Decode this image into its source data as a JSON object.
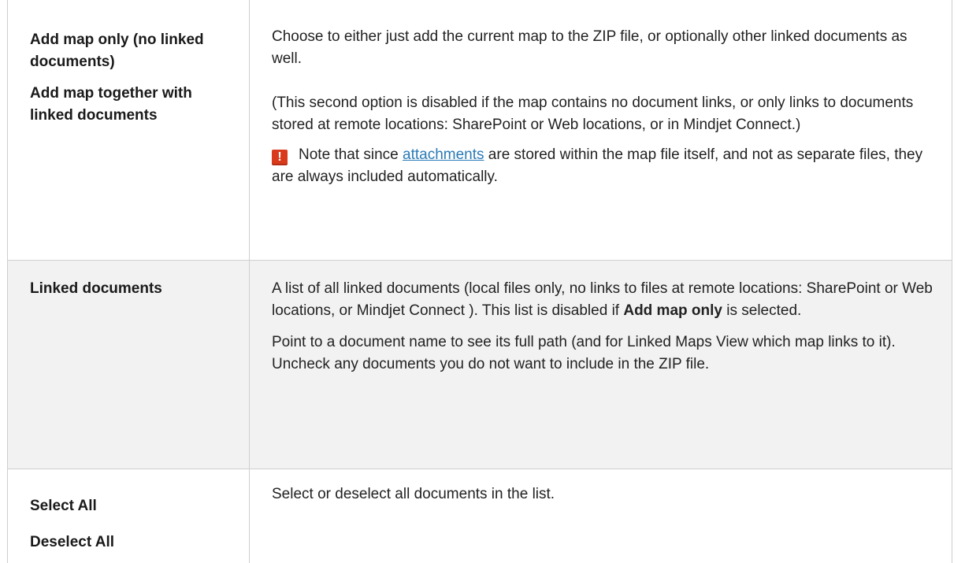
{
  "rows": [
    {
      "labels": [
        "Add map only (no linked documents)",
        "Add map together with linked documents"
      ],
      "desc": {
        "p1": "Choose to either just add the current map to the ZIP file, or optionally other linked documents as well.",
        "p2": "(This second option is disabled if the map contains no document links, or only links to documents stored at remote locations: SharePoint or Web locations, or in Mindjet Connect.)",
        "note_icon": "exclamation-warning-icon",
        "note_prefix": "Note that  since ",
        "note_link": "attachments",
        "note_suffix": " are stored within the map file itself, and not as separate files, they are always included automatically."
      }
    },
    {
      "labels": [
        "Linked documents"
      ],
      "desc": {
        "p1_prefix": "A list of all linked documents (local files only, no links to files at  remote locations: SharePoint or Web locations, or Mindjet Connect ). This list is disabled if ",
        "p1_bold": "Add map only",
        "p1_suffix": " is selected.",
        "p2": "Point to a document name to see its full path (and for Linked Maps View which map links to it). Uncheck any documents you do not want to include in the ZIP file."
      }
    },
    {
      "labels": [
        "Select All",
        "Deselect All"
      ],
      "desc": {
        "p1": "Select or deselect all documents in the list."
      }
    }
  ],
  "colors": {
    "border": "#cfcfcf",
    "shaded_row": "#f2f2f2",
    "link": "#2a7ab6",
    "warning_icon": "#d93a1c"
  }
}
